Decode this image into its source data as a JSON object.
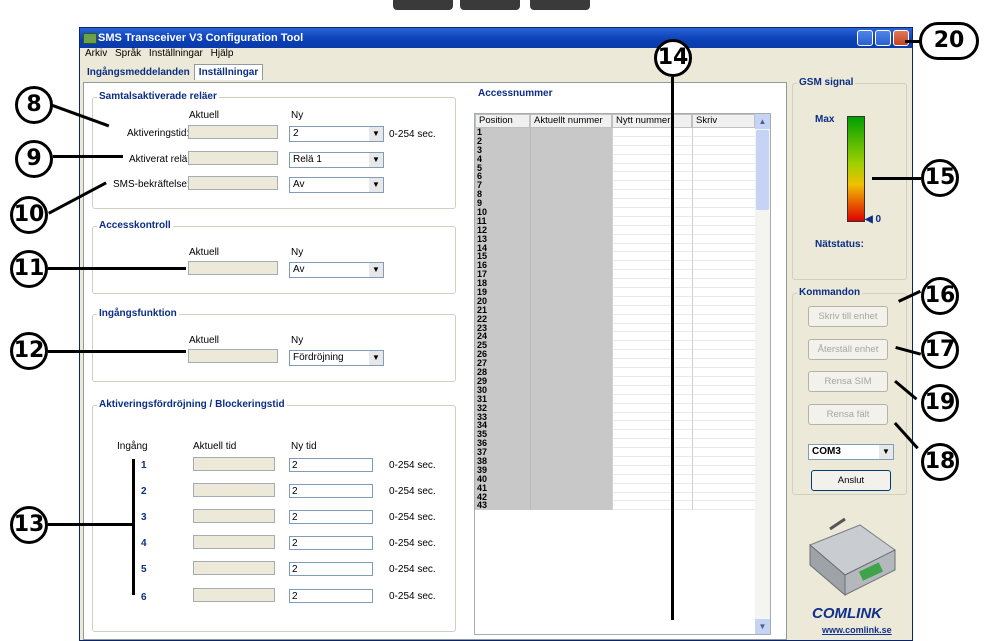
{
  "window": {
    "title": "SMS Transceiver V3 Configuration Tool"
  },
  "menu": [
    "Arkiv",
    "Språk",
    "Inställningar",
    "Hjälp"
  ],
  "tabs": [
    "Ingångsmeddelanden",
    "Inställningar"
  ],
  "samtal": {
    "title": "Samtalsaktiverade reläer",
    "col_aktuell": "Aktuell",
    "col_ny": "Ny",
    "rows": [
      {
        "label": "Aktiveringstid:",
        "value": "2",
        "unit": "0-254 sec."
      },
      {
        "label": "Aktiverat relä:",
        "value": "Relä 1",
        "unit": ""
      },
      {
        "label": "SMS-bekräftelse:",
        "value": "Av",
        "unit": ""
      }
    ]
  },
  "access": {
    "title": "Accesskontroll",
    "col_aktuell": "Aktuell",
    "col_ny": "Ny",
    "value": "Av"
  },
  "ingang": {
    "title": "Ingångsfunktion",
    "col_aktuell": "Aktuell",
    "col_ny": "Ny",
    "value": "Fördröjning"
  },
  "fordrojning": {
    "title": "Aktiveringsfördröjning / Blockeringstid",
    "col_ingang": "Ingång",
    "col_aktuell": "Aktuell tid",
    "col_ny": "Ny tid",
    "rows": [
      {
        "num": "1",
        "value": "2",
        "unit": "0-254 sec."
      },
      {
        "num": "2",
        "value": "2",
        "unit": "0-254 sec."
      },
      {
        "num": "3",
        "value": "2",
        "unit": "0-254 sec."
      },
      {
        "num": "4",
        "value": "2",
        "unit": "0-254 sec."
      },
      {
        "num": "5",
        "value": "2",
        "unit": "0-254 sec."
      },
      {
        "num": "6",
        "value": "2",
        "unit": "0-254 sec."
      }
    ]
  },
  "accessnummer": {
    "title": "Accessnummer",
    "headers": [
      "Position",
      "Aktuellt nummer",
      "Nytt nummer",
      "Skriv"
    ],
    "positions": [
      "1",
      "2",
      "3",
      "4",
      "5",
      "6",
      "7",
      "8",
      "9",
      "10",
      "11",
      "12",
      "13",
      "14",
      "15",
      "16",
      "17",
      "18",
      "19",
      "20",
      "21",
      "22",
      "23",
      "24",
      "25",
      "26",
      "27",
      "28",
      "29",
      "30",
      "31",
      "32",
      "33",
      "34",
      "35",
      "36",
      "37",
      "38",
      "39",
      "40",
      "41",
      "42",
      "43"
    ]
  },
  "gsm": {
    "title": "GSM signal",
    "max": "Max",
    "min": "0",
    "status": "Nätstatus:",
    "level": 0
  },
  "kommandon": {
    "title": "Kommandon",
    "buttons": [
      "Skriv till enhet",
      "Återställ enhet",
      "Rensa SIM",
      "Rensa fält"
    ],
    "port": "COM3",
    "connect": "Anslut"
  },
  "brand": {
    "logo": "COMLINK",
    "url": "www.comlink.se"
  },
  "callouts": [
    "8",
    "9",
    "10",
    "11",
    "12",
    "13",
    "14",
    "15",
    "16",
    "17",
    "18",
    "19",
    "20"
  ],
  "colors": {
    "title_bar": "#0a3fb5",
    "group_title": "#0b2d84",
    "panel": "#ece9d8"
  }
}
